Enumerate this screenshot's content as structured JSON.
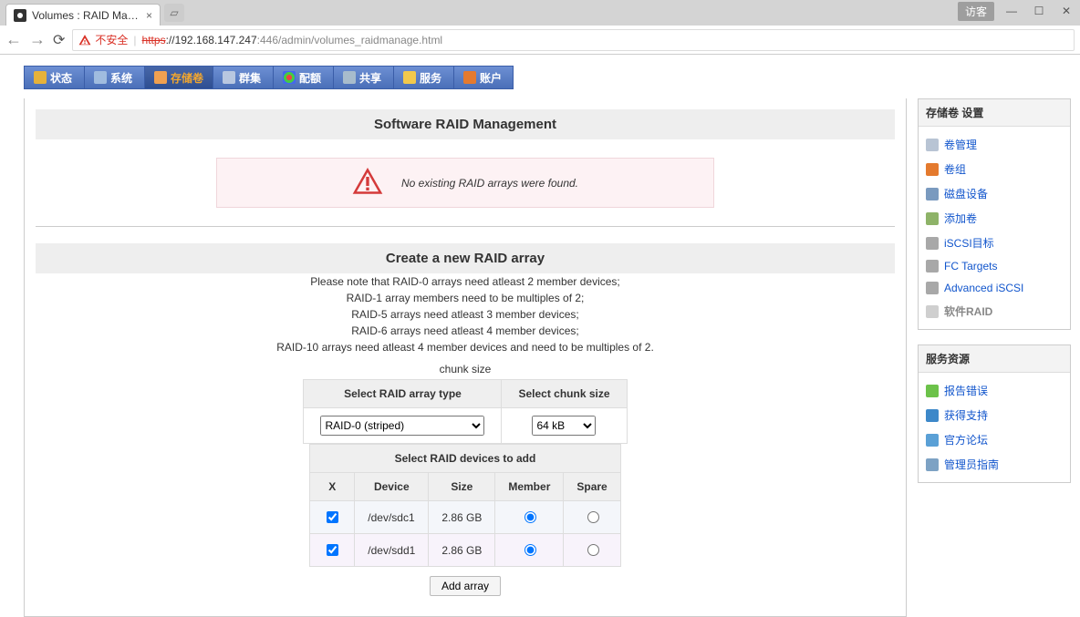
{
  "browser": {
    "tab_title": "Volumes : RAID Manag",
    "visitor_badge": "访客",
    "insecure_label": "不安全",
    "url_scheme": "https",
    "url_host": "://192.168.147.247",
    "url_port_path": ":446/admin/volumes_raidmanage.html"
  },
  "topnav": {
    "items": [
      {
        "label": "状态"
      },
      {
        "label": "系统"
      },
      {
        "label": "存储卷"
      },
      {
        "label": "群集"
      },
      {
        "label": "配额"
      },
      {
        "label": "共享"
      },
      {
        "label": "服务"
      },
      {
        "label": "账户"
      }
    ]
  },
  "main": {
    "title1": "Software RAID Management",
    "alert": "No existing RAID arrays were found.",
    "title2": "Create a new RAID array",
    "note_lines": {
      "l1": "Please note that RAID-0 arrays need atleast 2 member devices;",
      "l2": "RAID-1 array members need to be multiples of 2;",
      "l3": "RAID-5 arrays need atleast 3 member devices;",
      "l4": "RAID-6 arrays need atleast 4 member devices;",
      "l5": "RAID-10 arrays need atleast 4 member devices and need to be multiples of 2."
    },
    "chunk_label": "chunk size",
    "headers": {
      "raid_type": "Select RAID array type",
      "chunk_size": "Select chunk size"
    },
    "raid_type_value": "RAID-0 (striped)",
    "chunk_value": "64 kB",
    "devices_header": "Select RAID devices to add",
    "dev_cols": {
      "x": "X",
      "device": "Device",
      "size": "Size",
      "member": "Member",
      "spare": "Spare"
    },
    "devices": [
      {
        "dev": "/dev/sdc1",
        "size": "2.86 GB"
      },
      {
        "dev": "/dev/sdd1",
        "size": "2.86 GB"
      }
    ],
    "add_btn": "Add array"
  },
  "sidebar": {
    "box1_title": "存储卷 设置",
    "box1_items": {
      "i0": "卷管理",
      "i1": "卷组",
      "i2": "磁盘设备",
      "i3": "添加卷",
      "i4": "iSCSI目标",
      "i5": "FC Targets",
      "i6": "Advanced iSCSI",
      "i7": "软件RAID"
    },
    "box2_title": "服务资源",
    "box2_items": {
      "i0": "报告错误",
      "i1": "获得支持",
      "i2": "官方论坛",
      "i3": "管理员指南"
    }
  }
}
